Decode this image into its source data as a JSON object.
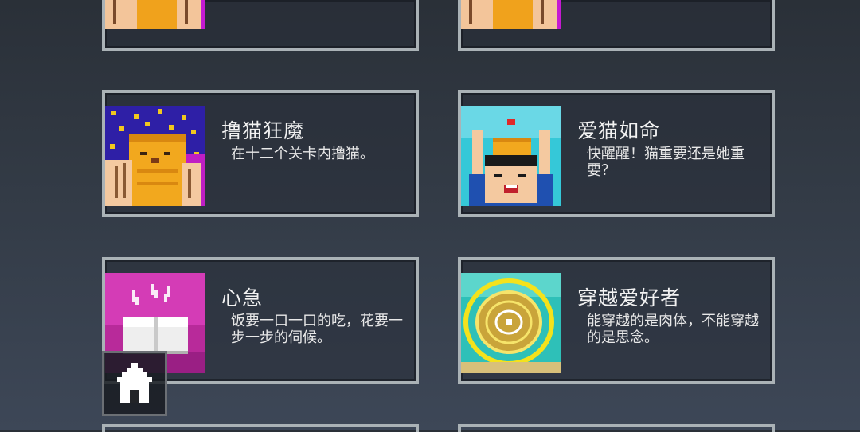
{
  "achievements": [
    {
      "title": "",
      "description": "",
      "icon": "cat-petting-icon"
    },
    {
      "title": "",
      "description": "",
      "icon": "cat-petting-icon"
    },
    {
      "title": "撸猫狂魔",
      "description": "在十二个关卡内撸猫。",
      "icon": "cat-petting-icon"
    },
    {
      "title": "爱猫如命",
      "description": "快醒醒！猫重要还是她重要？",
      "icon": "cat-on-head-icon"
    },
    {
      "title": "心急",
      "description": "饭要一口一口的吃，花要一步一步的伺候。",
      "icon": "hot-tofu-icon"
    },
    {
      "title": "穿越爱好者",
      "description": "能穿越的是肉体，不能穿越的是思念。",
      "icon": "portal-icon"
    }
  ],
  "home_button": {
    "icon": "home-icon"
  },
  "colors": {
    "border": "#aab2b6",
    "background_top": "#2a3038",
    "background_bottom": "#3d4757"
  }
}
